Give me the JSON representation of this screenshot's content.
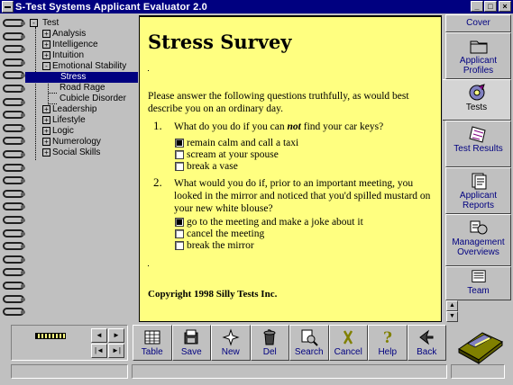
{
  "window": {
    "title": "S-Test Systems Applicant Evaluator 2.0",
    "minimize": "_",
    "maximize": "□",
    "close": "×"
  },
  "tree": {
    "root": "Test",
    "items": [
      {
        "label": "Analysis",
        "expander": "+"
      },
      {
        "label": "Intelligence",
        "expander": "+"
      },
      {
        "label": "Intuition",
        "expander": "+"
      },
      {
        "label": "Emotional Stability",
        "expander": "-"
      },
      {
        "label": "Stress",
        "selected": true
      },
      {
        "label": "Road Rage"
      },
      {
        "label": "Cubicle Disorder"
      },
      {
        "label": "Leadership",
        "expander": "+"
      },
      {
        "label": "Lifestyle",
        "expander": "+"
      },
      {
        "label": "Logic",
        "expander": "+"
      },
      {
        "label": "Numerology",
        "expander": "+"
      },
      {
        "label": "Social Skills",
        "expander": "+"
      }
    ],
    "root_expander": "-"
  },
  "page": {
    "heading": "Stress Survey",
    "intro": "Please answer the following questions truthfully, as would best describe you on an ordinary day.",
    "questions": [
      {
        "number": "1.",
        "text_before": "What do you do if you can ",
        "text_emph": "not",
        "text_after": " find your car keys?",
        "options": [
          {
            "label": "remain calm and call a taxi",
            "checked": true
          },
          {
            "label": "scream at your spouse",
            "checked": false
          },
          {
            "label": "break a vase",
            "checked": false
          }
        ]
      },
      {
        "number": "2.",
        "text": "What would you do if, prior to an important meeting, you looked in the mirror and noticed that you'd spilled mustard on your new white blouse?",
        "options": [
          {
            "label": "go to the meeting and make a joke about it",
            "checked": true
          },
          {
            "label": "cancel the meeting",
            "checked": false
          },
          {
            "label": "break the mirror",
            "checked": false
          }
        ]
      }
    ],
    "copyright": "Copyright 1998 Silly Tests Inc."
  },
  "tabs": [
    {
      "label": "Cover",
      "icon": "cover-icon"
    },
    {
      "label": "Applicant Profiles",
      "icon": "folder-icon"
    },
    {
      "label": "Tests",
      "icon": "tests-disc-icon",
      "active": true
    },
    {
      "label": "Test Results",
      "icon": "test-results-icon"
    },
    {
      "label": "Applicant Reports",
      "icon": "reports-icon"
    },
    {
      "label": "Management Overviews",
      "icon": "overview-icon"
    },
    {
      "label": "Team",
      "icon": "team-icon"
    }
  ],
  "nav": {
    "prev": "◄",
    "next": "►",
    "first": "|◄",
    "last": "►|"
  },
  "toolbar": [
    {
      "label": "Table",
      "icon": "table-icon"
    },
    {
      "label": "Save",
      "icon": "save-icon"
    },
    {
      "label": "New",
      "icon": "new-icon"
    },
    {
      "label": "Del",
      "icon": "delete-icon"
    },
    {
      "label": "Search",
      "icon": "search-icon"
    },
    {
      "label": "Cancel",
      "icon": "cancel-icon"
    },
    {
      "label": "Help",
      "icon": "help-icon"
    },
    {
      "label": "Back",
      "icon": "back-icon"
    }
  ],
  "colors": {
    "titlebar": "#000080",
    "page": "#ffff80",
    "selection": "#000080",
    "tab_text": "#000080"
  }
}
